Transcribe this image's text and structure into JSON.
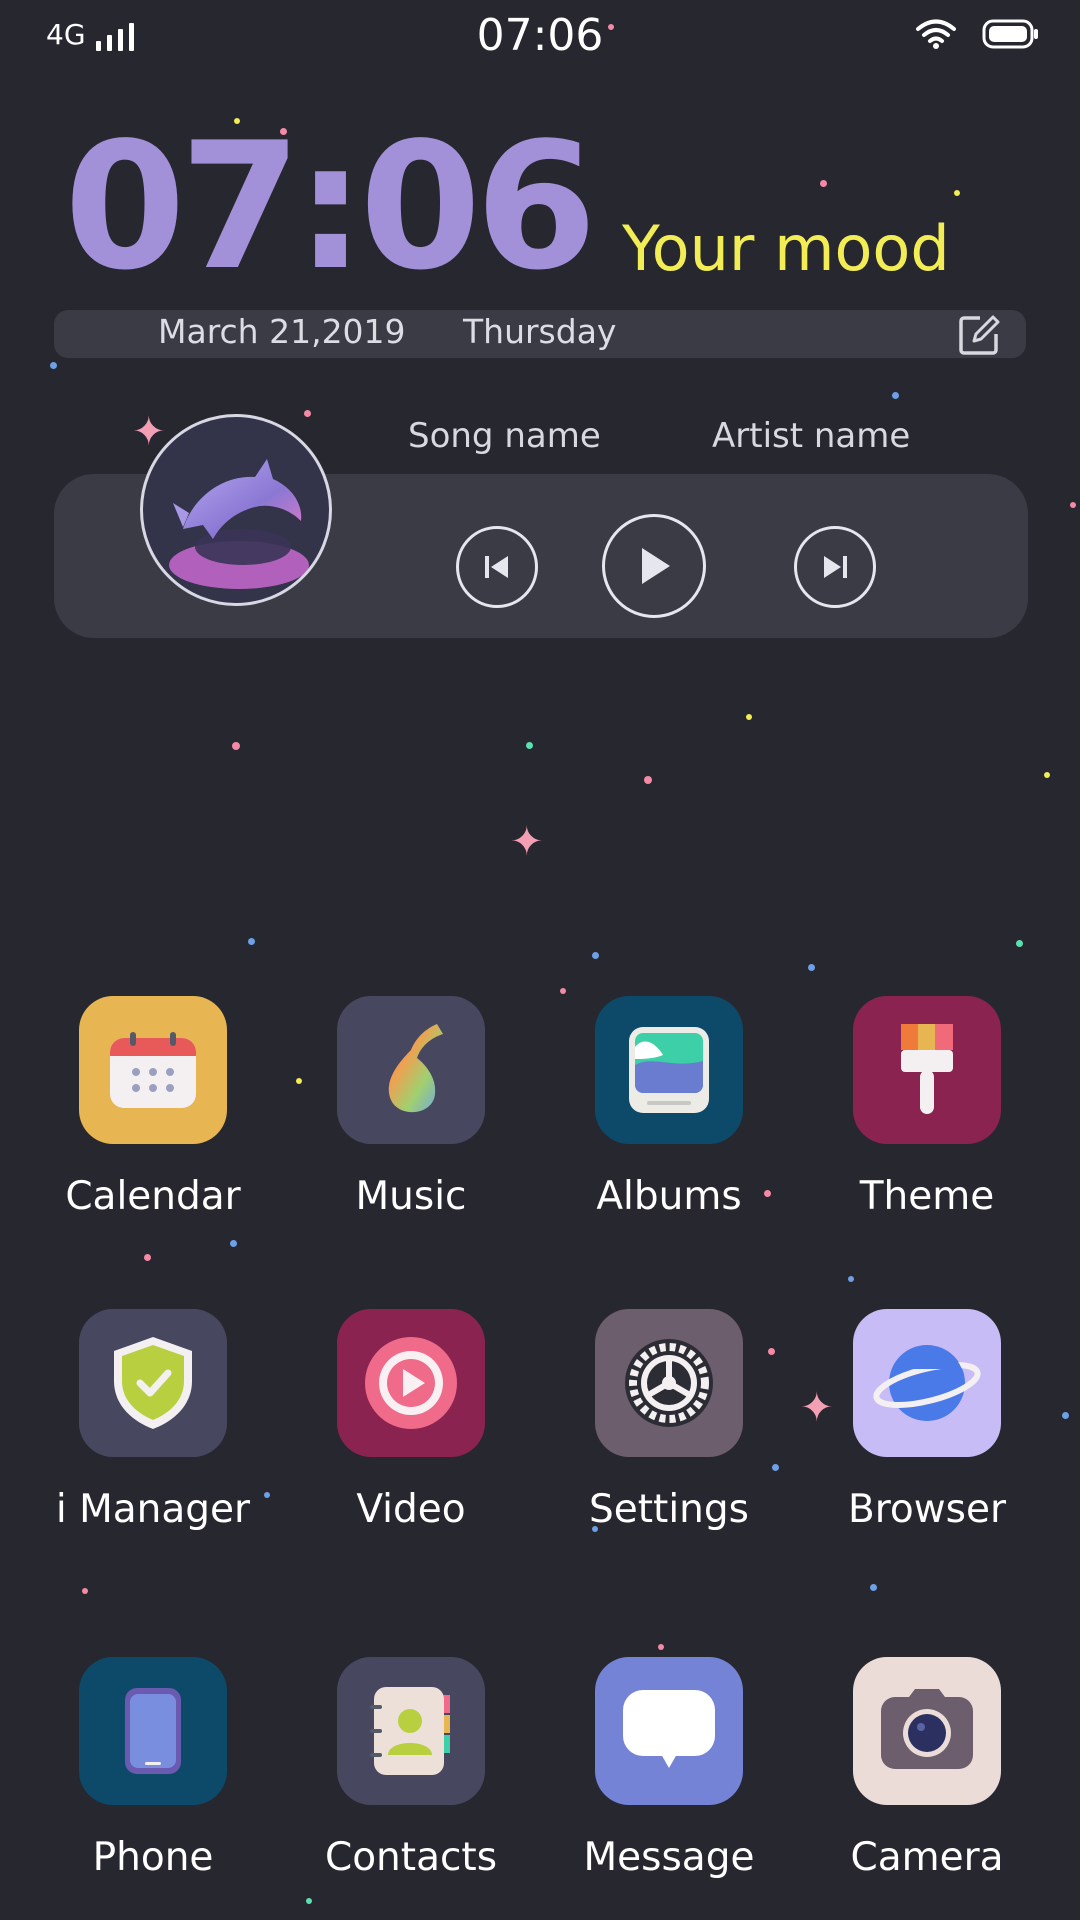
{
  "status_bar": {
    "network": "4G",
    "time": "07:06",
    "icons": [
      "signal-icon",
      "wifi-icon",
      "battery-icon"
    ]
  },
  "clock_widget": {
    "time": "07:06",
    "mood": "Your mood",
    "date": "March 21,2019",
    "weekday": "Thursday",
    "colors": {
      "clock": "#a290d8",
      "mood": "#f2ec55"
    }
  },
  "music_widget": {
    "song_name": "Song name",
    "artist_name": "Artist name",
    "controls": [
      "previous-icon",
      "play-icon",
      "next-icon"
    ]
  },
  "apps": [
    {
      "label": "Calendar",
      "icon": "calendar-icon",
      "color": "#e8b553"
    },
    {
      "label": "Music",
      "icon": "music-note-icon",
      "color": "#474860"
    },
    {
      "label": "Albums",
      "icon": "albums-icon",
      "color": "#0d4a6a"
    },
    {
      "label": "Theme",
      "icon": "paintbrush-icon",
      "color": "#8a2350"
    },
    {
      "label": "i Manager",
      "icon": "shield-check-icon",
      "color": "#474860"
    },
    {
      "label": "Video",
      "icon": "video-play-icon",
      "color": "#8a2350"
    },
    {
      "label": "Settings",
      "icon": "gear-icon",
      "color": "#6c5e6c"
    },
    {
      "label": "Browser",
      "icon": "planet-icon",
      "color": "#c8bcf6"
    },
    {
      "label": "Phone",
      "icon": "phone-icon",
      "color": "#0d4a6a"
    },
    {
      "label": "Contacts",
      "icon": "contacts-icon",
      "color": "#474860"
    },
    {
      "label": "Message",
      "icon": "message-icon",
      "color": "#7483d6"
    },
    {
      "label": "Camera",
      "icon": "camera-icon",
      "color": "#ecdcd8"
    }
  ]
}
